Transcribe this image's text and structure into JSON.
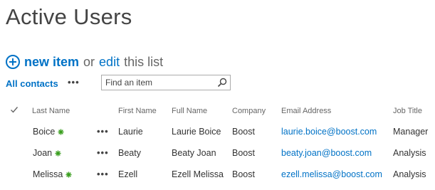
{
  "page": {
    "title": "Active Users"
  },
  "toolbar": {
    "new_item": "new item",
    "or": "or",
    "edit": "edit",
    "this_list": "this list"
  },
  "views": {
    "current": "All contacts",
    "more": "•••"
  },
  "search": {
    "placeholder": "Find an item"
  },
  "table": {
    "columns": [
      "Last Name",
      "First Name",
      "Full Name",
      "Company",
      "Email Address",
      "Job Title"
    ],
    "rows": [
      {
        "last": "Boice",
        "first": "Laurie",
        "full": "Laurie Boice",
        "company": "Boost",
        "email": "laurie.boice@boost.com",
        "job": "Manager"
      },
      {
        "last": "Joan",
        "first": "Beaty",
        "full": "Beaty Joan",
        "company": "Boost",
        "email": "beaty.joan@boost.com",
        "job": "Analysis"
      },
      {
        "last": "Melissa",
        "first": "Ezell",
        "full": "Ezell Melissa",
        "company": "Boost",
        "email": "ezell.melissa@boost.com",
        "job": "Analysis"
      }
    ],
    "row_menu": "•••"
  },
  "colors": {
    "accent": "#0072c6",
    "new_badge": "#3a9e1f"
  }
}
